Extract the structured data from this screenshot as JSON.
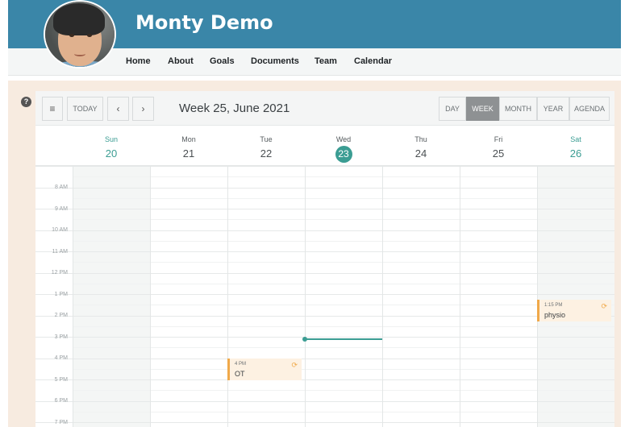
{
  "profile": {
    "name": "Monty Demo"
  },
  "nav": [
    "Home",
    "About",
    "Goals",
    "Documents",
    "Team",
    "Calendar"
  ],
  "help_icon": "?",
  "toolbar": {
    "menu_icon": "≡",
    "today_label": "TODAY",
    "prev_icon": "‹",
    "next_icon": "›",
    "title": "Week 25, June 2021",
    "views": [
      "DAY",
      "WEEK",
      "MONTH",
      "YEAR",
      "AGENDA"
    ],
    "active_view": "WEEK"
  },
  "days": [
    {
      "name": "Sun",
      "num": "20"
    },
    {
      "name": "Mon",
      "num": "21"
    },
    {
      "name": "Tue",
      "num": "22"
    },
    {
      "name": "Wed",
      "num": "23"
    },
    {
      "name": "Thu",
      "num": "24"
    },
    {
      "name": "Fri",
      "num": "25"
    },
    {
      "name": "Sat",
      "num": "26"
    }
  ],
  "today_index": 3,
  "times": [
    "8 AM",
    "9 AM",
    "10 AM",
    "11 AM",
    "12 PM",
    "1 PM",
    "2 PM",
    "3 PM",
    "4 PM",
    "5 PM",
    "6 PM",
    "7 PM"
  ],
  "events": [
    {
      "time": "4 PM",
      "title": "OT",
      "repeat_icon": "⟳"
    },
    {
      "time": "1:15 PM",
      "title": "physio",
      "repeat_icon": "⟳"
    }
  ],
  "colors": {
    "header": "#3a86a8",
    "accent": "#3b9d93",
    "event_border": "#f0a94a",
    "panel": "#f7ebe0"
  }
}
